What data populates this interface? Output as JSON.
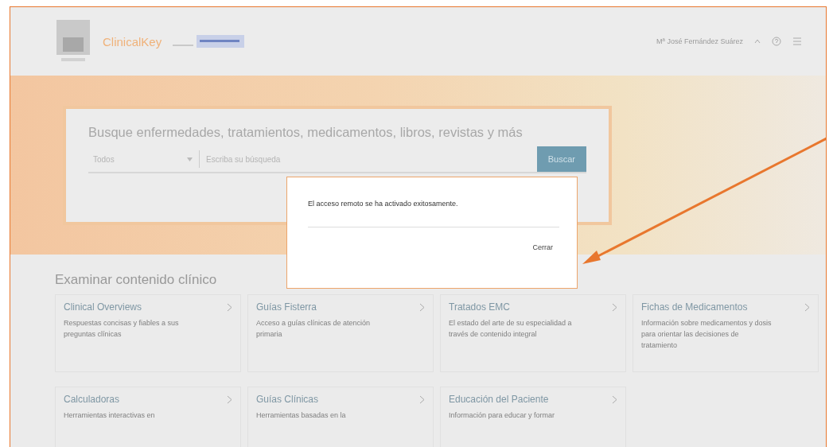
{
  "header": {
    "brand": "ClinicalKey",
    "user_name": "Mª José Fernández Suárez"
  },
  "search": {
    "heading": "Busque enfermedades, tratamientos, medicamentos, libros, revistas y más",
    "scope": "Todos",
    "placeholder": "Escriba su búsqueda",
    "button": "Buscar"
  },
  "dialog": {
    "message": "El acceso remoto se ha activado exitosamente.",
    "button": "Cerrar"
  },
  "browse": {
    "heading": "Examinar contenido clínico",
    "cards": [
      {
        "title": "Clinical Overviews",
        "description": "Respuestas concisas y fiables a sus preguntas clínicas"
      },
      {
        "title": "Guías Fisterra",
        "description": "Acceso a guías clínicas de atención primaria"
      },
      {
        "title": "Tratados EMC",
        "description": "El estado del arte de su especialidad a través de contenido integral"
      },
      {
        "title": "Fichas de Medicamentos",
        "description": "Información sobre medicamentos y dosis para orientar las decisiones de tratamiento"
      },
      {
        "title": "Calculadoras",
        "description": "Herramientas interactivas en"
      },
      {
        "title": "Guías Clínicas",
        "description": "Herramientas basadas en la"
      },
      {
        "title": "Educación del Paciente",
        "description": "Información para educar y formar"
      }
    ]
  }
}
